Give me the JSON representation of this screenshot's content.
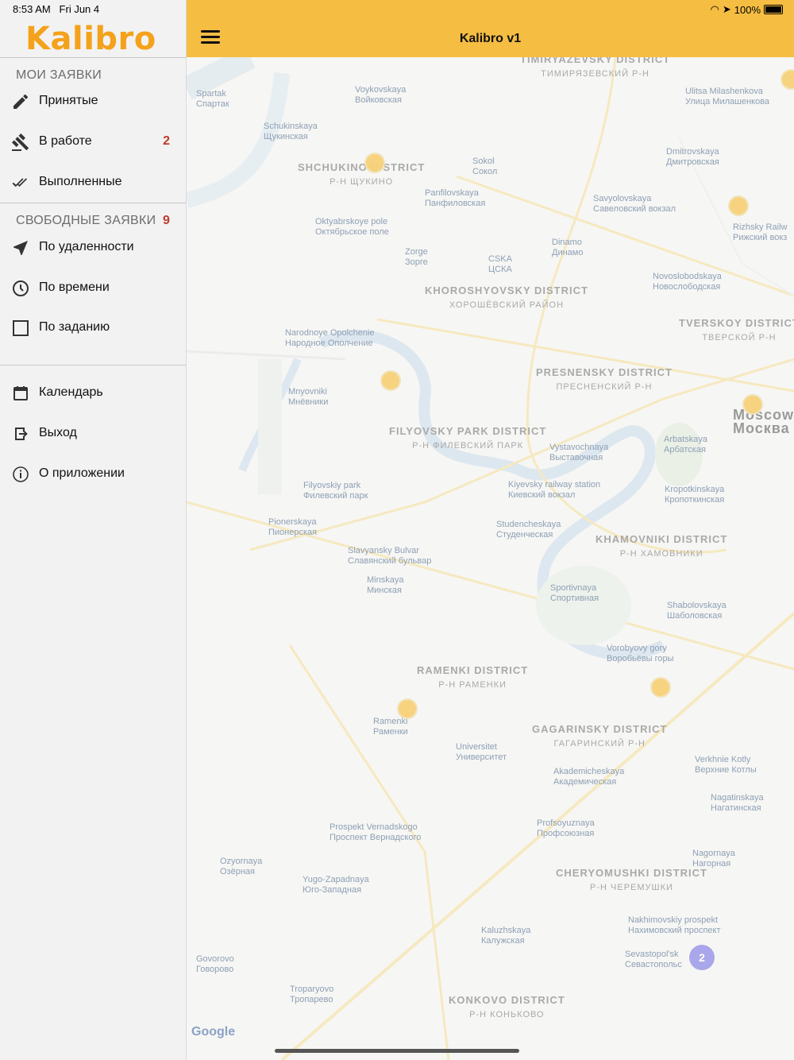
{
  "status": {
    "time": "8:53 AM",
    "date": "Fri Jun 4",
    "battery": "100%"
  },
  "app": {
    "logo": "Kalibro",
    "title": "Kalibro v1"
  },
  "menu": {
    "my_section": "МОИ ЗАЯВКИ",
    "my_items": [
      {
        "label": "Принятые",
        "icon": "pencil-icon",
        "badge": ""
      },
      {
        "label": "В работе",
        "icon": "gavel-icon",
        "badge": "2"
      },
      {
        "label": "Выполненные",
        "icon": "double-check-icon",
        "badge": ""
      }
    ],
    "free_section": "СВОБОДНЫЕ ЗАЯВКИ",
    "free_count": "9",
    "free_items": [
      {
        "label": "По удаленности",
        "icon": "location-arrow-icon"
      },
      {
        "label": "По времени",
        "icon": "clock-icon"
      },
      {
        "label": "По заданию",
        "icon": "square-icon"
      }
    ],
    "bottom_items": [
      {
        "label": "Календарь",
        "icon": "calendar-icon"
      },
      {
        "label": "Выход",
        "icon": "logout-icon"
      },
      {
        "label": "О приложении",
        "icon": "info-icon"
      }
    ]
  },
  "map": {
    "labels": [
      {
        "en": "Spartak",
        "ru": "Спартак"
      },
      {
        "en": "Voykovskaya",
        "ru": "Войковская"
      },
      {
        "en": "Schukinskaya",
        "ru": "Щукинская"
      },
      {
        "en": "Sokol",
        "ru": "Сокол"
      },
      {
        "en": "Panfilovskaya",
        "ru": "Панфиловская"
      },
      {
        "en": "Oktyabrskoye pole",
        "ru": "Октябрьское поле"
      },
      {
        "en": "Zorge",
        "ru": "Зорге"
      },
      {
        "en": "CSKA",
        "ru": "ЦСКА"
      },
      {
        "en": "Dinamo",
        "ru": "Динамо"
      },
      {
        "en": "Savyolovskaya",
        "ru": "Савеловский вокзал"
      },
      {
        "en": "Dmitrovskaya",
        "ru": "Дмитровская"
      },
      {
        "en": "Ulitsa Milashenkova",
        "ru": "Улица Милашенкова"
      },
      {
        "en": "Rizhsky Railw",
        "ru": "Рижский вокз"
      },
      {
        "en": "Novoslobodskaya",
        "ru": "Новослободская"
      },
      {
        "en": "Narodnoye Opolchenie",
        "ru": "Народное Ополчение"
      },
      {
        "en": "Mnyovniki",
        "ru": "Мнёвники"
      },
      {
        "en": "Vystavochnaya",
        "ru": "Выставочная"
      },
      {
        "en": "Arbatskaya",
        "ru": "Арбатская"
      },
      {
        "en": "Filyovskiy park",
        "ru": "Филевский парк"
      },
      {
        "en": "Kiyevsky railway station",
        "ru": "Киевский вокзал"
      },
      {
        "en": "Kropotkinskaya",
        "ru": "Кропоткинская"
      },
      {
        "en": "Pionerskaya",
        "ru": "Пионерская"
      },
      {
        "en": "Studencheskaya",
        "ru": "Студенческая"
      },
      {
        "en": "Slavyansky Bulvar",
        "ru": "Славянский бульвар"
      },
      {
        "en": "Minskaya",
        "ru": "Минская"
      },
      {
        "en": "Sportivnaya",
        "ru": "Спортивная"
      },
      {
        "en": "Shabolovskaya",
        "ru": "Шаболовская"
      },
      {
        "en": "Vorobyovy gory",
        "ru": "Воробьёвы горы"
      },
      {
        "en": "Ramenki",
        "ru": "Раменки"
      },
      {
        "en": "Universitet",
        "ru": "Университет"
      },
      {
        "en": "Akademicheskaya",
        "ru": "Академическая"
      },
      {
        "en": "Verkhnie Kotly",
        "ru": "Верхние Котлы"
      },
      {
        "en": "Nagatinskaya",
        "ru": "Нагатинская"
      },
      {
        "en": "Prospekt Vernadskogo",
        "ru": "Проспект Вернадского"
      },
      {
        "en": "Profsoyuznaya",
        "ru": "Профсоюзная"
      },
      {
        "en": "Nagornaya",
        "ru": "Нагорная"
      },
      {
        "en": "Ozyornaya",
        "ru": "Озёрная"
      },
      {
        "en": "Yugo-Zapadnaya",
        "ru": "Юго-Западная"
      },
      {
        "en": "Nakhimovskiy prospekt",
        "ru": "Нахимовский проспект"
      },
      {
        "en": "Kaluzhskaya",
        "ru": "Калужская"
      },
      {
        "en": "Sevastopol'sk",
        "ru": "Севастопольс"
      },
      {
        "en": "Govorovo",
        "ru": "Говорово"
      },
      {
        "en": "Troparyovo",
        "ru": "Тропарево"
      }
    ],
    "districts": [
      {
        "en": "SHCHUKINO DISTRICT",
        "ru": "Р-Н ЩУКИНО"
      },
      {
        "en": "KHOROSHYOVSKY DISTRICT",
        "ru": "ХОРОШЁВСКИЙ РАЙОН"
      },
      {
        "en": "TVERSKOY DISTRICT",
        "ru": "ТВЕРСКОЙ Р-Н"
      },
      {
        "en": "PRESNENSKY DISTRICT",
        "ru": "ПРЕСНЕНСКИЙ Р-Н"
      },
      {
        "en": "FILYOVSKY PARK DISTRICT",
        "ru": "Р-Н ФИЛЕВСКИЙ ПАРК"
      },
      {
        "en": "KHAMOVNIKI DISTRICT",
        "ru": "Р-Н ХАМОВНИКИ"
      },
      {
        "en": "RAMENKI DISTRICT",
        "ru": "Р-Н РАМЕНКИ"
      },
      {
        "en": "GAGARINSKY DISTRICT",
        "ru": "ГАГАРИНСКИЙ Р-Н"
      },
      {
        "en": "CHERYOMUSHKI DISTRICT",
        "ru": "Р-Н ЧЕРЕМУШКИ"
      },
      {
        "en": "KONKOVO DISTRICT",
        "ru": "Р-Н КОНЬКОВО"
      },
      {
        "en": "TIMIRYAZEVSKY DISTRICT",
        "ru": "ТИМИРЯЗЕВСКИЙ Р-Н"
      }
    ],
    "city": {
      "en": "Moscow",
      "ru": "Москва"
    },
    "cluster_count": "2",
    "attribution": "Google"
  }
}
